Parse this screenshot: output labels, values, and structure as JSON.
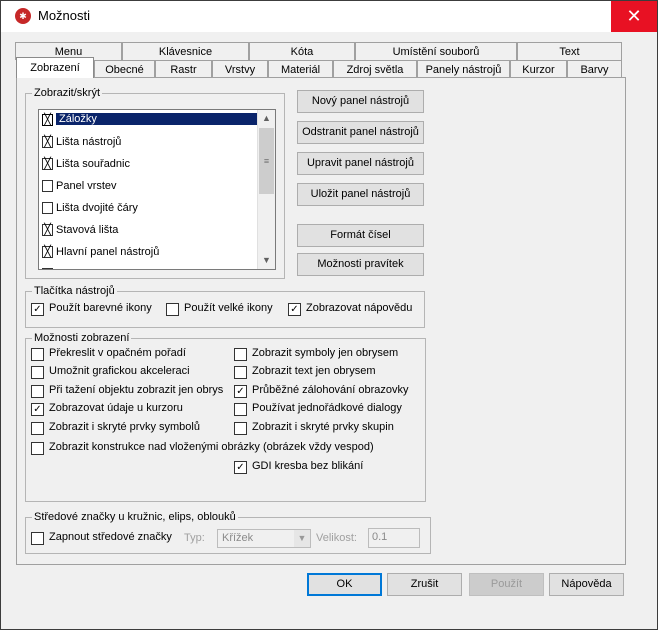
{
  "window": {
    "title": "Možnosti",
    "close": "✕"
  },
  "tabs": {
    "row1": [
      "Menu",
      "Klávesnice",
      "Kóta",
      "Umístění souborů",
      "Text"
    ],
    "row2": [
      "Zobrazení",
      "Obecné",
      "Rastr",
      "Vrstvy",
      "Materiál",
      "Zdroj světla",
      "Panely nástrojů",
      "Kurzor",
      "Barvy"
    ],
    "active": "Zobrazení"
  },
  "show_hide": {
    "legend": "Zobrazit/skrýt",
    "items": [
      {
        "label": "Záložky",
        "checked": true,
        "selected": true
      },
      {
        "label": "Lišta nástrojů",
        "checked": true
      },
      {
        "label": "Lišta souřadnic",
        "checked": true
      },
      {
        "label": "Panel vrstev",
        "checked": false
      },
      {
        "label": "Lišta dvojité čáry",
        "checked": false
      },
      {
        "label": "Stavová lišta",
        "checked": true
      },
      {
        "label": "Hlavní panel nástrojů",
        "checked": true
      }
    ]
  },
  "toolbar_buttons": {
    "new": "Nový panel nástrojů",
    "remove": "Odstranit panel nástrojů",
    "edit": "Upravit panel nástrojů",
    "save": "Uložit panel nástrojů",
    "number_format": "Formát čísel",
    "ruler_options": "Možnosti pravítek"
  },
  "tool_buttons": {
    "legend": "Tlačítka nástrojů",
    "color_icons": {
      "label": "Použít barevné ikony",
      "checked": true
    },
    "large_icons": {
      "label": "Použít velké ikony",
      "checked": false
    },
    "show_tooltips": {
      "label": "Zobrazovat nápovědu",
      "checked": true
    }
  },
  "display_options": {
    "legend": "Možnosti zobrazení",
    "redraw_reverse": {
      "label": "Překreslit v opačném pořadí",
      "checked": false
    },
    "graphics_accel": {
      "label": "Umožnit grafickou akceleraci",
      "checked": false
    },
    "drag_outline": {
      "label": "Při tažení objektu zobrazit jen obrys",
      "checked": false
    },
    "cursor_info": {
      "label": "Zobrazovat údaje u kurzoru",
      "checked": true
    },
    "hidden_symbol_parts": {
      "label": "Zobrazit i skryté prvky symbolů",
      "checked": false
    },
    "construction_over_images": {
      "label": "Zobrazit konstrukce nad vloženými obrázky (obrázek vždy vespod)",
      "checked": false
    },
    "symbol_outline": {
      "label": "Zobrazit symboly jen obrysem",
      "checked": false
    },
    "text_outline": {
      "label": "Zobrazit text jen obrysem",
      "checked": false
    },
    "continuous_backup": {
      "label": "Průběžné zálohování obrazovky",
      "checked": true
    },
    "single_line_dialogs": {
      "label": "Používat jednořádkové dialogy",
      "checked": false
    },
    "hidden_group_parts": {
      "label": "Zobrazit i skryté prvky skupin",
      "checked": false
    },
    "gdi_no_flicker": {
      "label": "GDI kresba bez blikání",
      "checked": true
    }
  },
  "center_marks": {
    "legend": "Středové značky u kružnic, elips, oblouků",
    "enable": {
      "label": "Zapnout středové značky",
      "checked": false
    },
    "type_label": "Typ:",
    "type_value": "Křížek",
    "size_label": "Velikost:",
    "size_value": "0.1"
  },
  "dialog_buttons": {
    "ok": "OK",
    "cancel": "Zrušit",
    "apply": "Použít",
    "help": "Nápověda"
  }
}
